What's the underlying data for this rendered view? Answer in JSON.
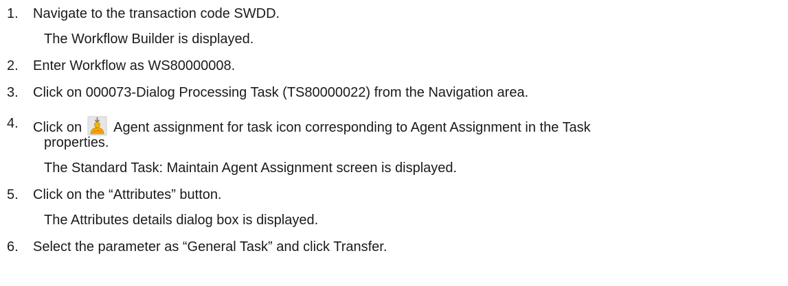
{
  "steps": [
    {
      "number": "1.",
      "text": "Navigate to the transaction code SWDD.",
      "result": "The Workflow Builder is displayed."
    },
    {
      "number": "2.",
      "text": "Enter Workflow as WS80000008."
    },
    {
      "number": "3.",
      "text": "Click on 000073-Dialog Processing Task (TS80000022) from the Navigation area."
    },
    {
      "number": "4.",
      "text_before_icon": "Click on",
      "icon": "agent-assignment-icon",
      "text_after_icon": "Agent assignment for task icon corresponding to Agent Assignment in the Task",
      "text_continued": "properties.",
      "result": "The Standard Task: Maintain Agent Assignment screen is displayed."
    },
    {
      "number": "5.",
      "text": "Click on the “Attributes” button.",
      "result": "The Attributes details dialog box is displayed."
    },
    {
      "number": "6.",
      "text": "Select the parameter as “General Task” and click Transfer."
    }
  ]
}
